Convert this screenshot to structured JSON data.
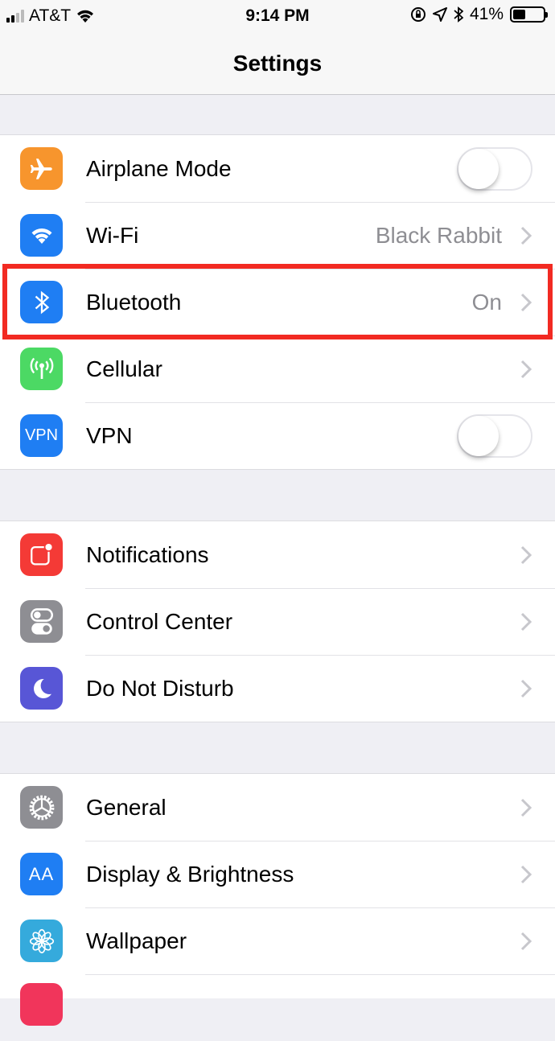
{
  "status_bar": {
    "carrier": "AT&T",
    "time": "9:14 PM",
    "battery_percent": "41%",
    "battery_level": 0.41,
    "icons": [
      "signal-icon",
      "wifi-icon",
      "rotation-lock-icon",
      "location-icon",
      "bluetooth-icon",
      "battery-icon"
    ]
  },
  "header": {
    "title": "Settings"
  },
  "groups": [
    {
      "items": [
        {
          "label": "Airplane Mode",
          "icon": "airplane-icon",
          "color": "#f7952d",
          "control": "toggle",
          "on": false
        },
        {
          "label": "Wi-Fi",
          "icon": "wifi-icon",
          "color": "#1f7ef3",
          "control": "chevron",
          "value": "Black Rabbit"
        },
        {
          "label": "Bluetooth",
          "icon": "bluetooth-icon",
          "color": "#1f7ef3",
          "control": "chevron",
          "value": "On",
          "highlighted": true
        },
        {
          "label": "Cellular",
          "icon": "antenna-icon",
          "color": "#4cd964",
          "control": "chevron"
        },
        {
          "label": "VPN",
          "icon": "vpn-icon",
          "icon_text": "VPN",
          "color": "#1f7ef3",
          "control": "toggle",
          "on": false
        }
      ]
    },
    {
      "items": [
        {
          "label": "Notifications",
          "icon": "notifications-icon",
          "color": "#f43a36",
          "control": "chevron"
        },
        {
          "label": "Control Center",
          "icon": "control-center-icon",
          "color": "#8e8e93",
          "control": "chevron"
        },
        {
          "label": "Do Not Disturb",
          "icon": "moon-icon",
          "color": "#5856d6",
          "control": "chevron"
        }
      ]
    },
    {
      "items": [
        {
          "label": "General",
          "icon": "gear-icon",
          "color": "#8e8e93",
          "control": "chevron"
        },
        {
          "label": "Display & Brightness",
          "icon": "text-size-icon",
          "icon_text": "AA",
          "color": "#1f7ef3",
          "control": "chevron"
        },
        {
          "label": "Wallpaper",
          "icon": "flower-icon",
          "color": "#35aadc",
          "control": "chevron"
        }
      ]
    }
  ],
  "highlight_color": "#f22a22"
}
